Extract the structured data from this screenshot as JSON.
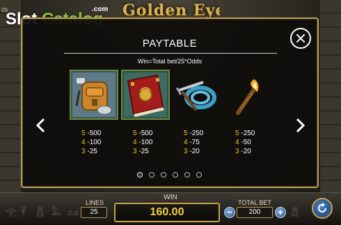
{
  "watermark": {
    "part1": "Slot",
    "part2": "Catalog",
    "suffix": ".com"
  },
  "game": {
    "logo_text": "Golden Eye",
    "corner_number": "09"
  },
  "paytable": {
    "title": "PAYTABLE",
    "formula": "Win=Total bet/25*Odds",
    "page_count": 6,
    "current_page": 1,
    "symbols": [
      {
        "name": "backpack-icon",
        "payouts": [
          {
            "count": "5",
            "value": "500"
          },
          {
            "count": "4",
            "value": "100"
          },
          {
            "count": "3",
            "value": "25"
          }
        ]
      },
      {
        "name": "book-icon",
        "payouts": [
          {
            "count": "5",
            "value": "500"
          },
          {
            "count": "4",
            "value": "100"
          },
          {
            "count": "3",
            "value": "25"
          }
        ]
      },
      {
        "name": "rope-pickaxe-icon",
        "payouts": [
          {
            "count": "5",
            "value": "250"
          },
          {
            "count": "4",
            "value": "75"
          },
          {
            "count": "3",
            "value": "20"
          }
        ]
      },
      {
        "name": "torch-icon",
        "payouts": [
          {
            "count": "5",
            "value": "250"
          },
          {
            "count": "4",
            "value": "50"
          },
          {
            "count": "3",
            "value": "20"
          }
        ]
      }
    ],
    "separator": "-"
  },
  "controls": {
    "lines_label": "LINES",
    "lines_value": "25",
    "win_label": "WIN",
    "win_value": "160.00",
    "total_bet_label": "TOTAL BET",
    "total_bet_value": "200",
    "minus_symbol": "−",
    "plus_symbol": "+"
  },
  "colors": {
    "panel_border": "#b79a5a",
    "payout_count": "#f0c419",
    "win_value": "#f4d03f",
    "button_blue": "#2f5c96"
  }
}
